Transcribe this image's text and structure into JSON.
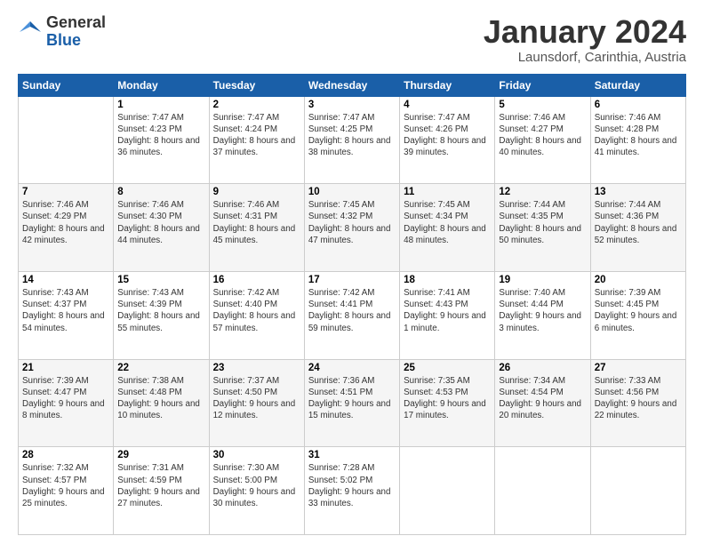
{
  "header": {
    "logo": {
      "line1": "General",
      "line2": "Blue"
    },
    "title": "January 2024",
    "location": "Launsdorf, Carinthia, Austria"
  },
  "weekdays": [
    "Sunday",
    "Monday",
    "Tuesday",
    "Wednesday",
    "Thursday",
    "Friday",
    "Saturday"
  ],
  "weeks": [
    [
      {
        "day": "",
        "sunrise": "",
        "sunset": "",
        "daylight": ""
      },
      {
        "day": "1",
        "sunrise": "Sunrise: 7:47 AM",
        "sunset": "Sunset: 4:23 PM",
        "daylight": "Daylight: 8 hours and 36 minutes."
      },
      {
        "day": "2",
        "sunrise": "Sunrise: 7:47 AM",
        "sunset": "Sunset: 4:24 PM",
        "daylight": "Daylight: 8 hours and 37 minutes."
      },
      {
        "day": "3",
        "sunrise": "Sunrise: 7:47 AM",
        "sunset": "Sunset: 4:25 PM",
        "daylight": "Daylight: 8 hours and 38 minutes."
      },
      {
        "day": "4",
        "sunrise": "Sunrise: 7:47 AM",
        "sunset": "Sunset: 4:26 PM",
        "daylight": "Daylight: 8 hours and 39 minutes."
      },
      {
        "day": "5",
        "sunrise": "Sunrise: 7:46 AM",
        "sunset": "Sunset: 4:27 PM",
        "daylight": "Daylight: 8 hours and 40 minutes."
      },
      {
        "day": "6",
        "sunrise": "Sunrise: 7:46 AM",
        "sunset": "Sunset: 4:28 PM",
        "daylight": "Daylight: 8 hours and 41 minutes."
      }
    ],
    [
      {
        "day": "7",
        "sunrise": "Sunrise: 7:46 AM",
        "sunset": "Sunset: 4:29 PM",
        "daylight": "Daylight: 8 hours and 42 minutes."
      },
      {
        "day": "8",
        "sunrise": "Sunrise: 7:46 AM",
        "sunset": "Sunset: 4:30 PM",
        "daylight": "Daylight: 8 hours and 44 minutes."
      },
      {
        "day": "9",
        "sunrise": "Sunrise: 7:46 AM",
        "sunset": "Sunset: 4:31 PM",
        "daylight": "Daylight: 8 hours and 45 minutes."
      },
      {
        "day": "10",
        "sunrise": "Sunrise: 7:45 AM",
        "sunset": "Sunset: 4:32 PM",
        "daylight": "Daylight: 8 hours and 47 minutes."
      },
      {
        "day": "11",
        "sunrise": "Sunrise: 7:45 AM",
        "sunset": "Sunset: 4:34 PM",
        "daylight": "Daylight: 8 hours and 48 minutes."
      },
      {
        "day": "12",
        "sunrise": "Sunrise: 7:44 AM",
        "sunset": "Sunset: 4:35 PM",
        "daylight": "Daylight: 8 hours and 50 minutes."
      },
      {
        "day": "13",
        "sunrise": "Sunrise: 7:44 AM",
        "sunset": "Sunset: 4:36 PM",
        "daylight": "Daylight: 8 hours and 52 minutes."
      }
    ],
    [
      {
        "day": "14",
        "sunrise": "Sunrise: 7:43 AM",
        "sunset": "Sunset: 4:37 PM",
        "daylight": "Daylight: 8 hours and 54 minutes."
      },
      {
        "day": "15",
        "sunrise": "Sunrise: 7:43 AM",
        "sunset": "Sunset: 4:39 PM",
        "daylight": "Daylight: 8 hours and 55 minutes."
      },
      {
        "day": "16",
        "sunrise": "Sunrise: 7:42 AM",
        "sunset": "Sunset: 4:40 PM",
        "daylight": "Daylight: 8 hours and 57 minutes."
      },
      {
        "day": "17",
        "sunrise": "Sunrise: 7:42 AM",
        "sunset": "Sunset: 4:41 PM",
        "daylight": "Daylight: 8 hours and 59 minutes."
      },
      {
        "day": "18",
        "sunrise": "Sunrise: 7:41 AM",
        "sunset": "Sunset: 4:43 PM",
        "daylight": "Daylight: 9 hours and 1 minute."
      },
      {
        "day": "19",
        "sunrise": "Sunrise: 7:40 AM",
        "sunset": "Sunset: 4:44 PM",
        "daylight": "Daylight: 9 hours and 3 minutes."
      },
      {
        "day": "20",
        "sunrise": "Sunrise: 7:39 AM",
        "sunset": "Sunset: 4:45 PM",
        "daylight": "Daylight: 9 hours and 6 minutes."
      }
    ],
    [
      {
        "day": "21",
        "sunrise": "Sunrise: 7:39 AM",
        "sunset": "Sunset: 4:47 PM",
        "daylight": "Daylight: 9 hours and 8 minutes."
      },
      {
        "day": "22",
        "sunrise": "Sunrise: 7:38 AM",
        "sunset": "Sunset: 4:48 PM",
        "daylight": "Daylight: 9 hours and 10 minutes."
      },
      {
        "day": "23",
        "sunrise": "Sunrise: 7:37 AM",
        "sunset": "Sunset: 4:50 PM",
        "daylight": "Daylight: 9 hours and 12 minutes."
      },
      {
        "day": "24",
        "sunrise": "Sunrise: 7:36 AM",
        "sunset": "Sunset: 4:51 PM",
        "daylight": "Daylight: 9 hours and 15 minutes."
      },
      {
        "day": "25",
        "sunrise": "Sunrise: 7:35 AM",
        "sunset": "Sunset: 4:53 PM",
        "daylight": "Daylight: 9 hours and 17 minutes."
      },
      {
        "day": "26",
        "sunrise": "Sunrise: 7:34 AM",
        "sunset": "Sunset: 4:54 PM",
        "daylight": "Daylight: 9 hours and 20 minutes."
      },
      {
        "day": "27",
        "sunrise": "Sunrise: 7:33 AM",
        "sunset": "Sunset: 4:56 PM",
        "daylight": "Daylight: 9 hours and 22 minutes."
      }
    ],
    [
      {
        "day": "28",
        "sunrise": "Sunrise: 7:32 AM",
        "sunset": "Sunset: 4:57 PM",
        "daylight": "Daylight: 9 hours and 25 minutes."
      },
      {
        "day": "29",
        "sunrise": "Sunrise: 7:31 AM",
        "sunset": "Sunset: 4:59 PM",
        "daylight": "Daylight: 9 hours and 27 minutes."
      },
      {
        "day": "30",
        "sunrise": "Sunrise: 7:30 AM",
        "sunset": "Sunset: 5:00 PM",
        "daylight": "Daylight: 9 hours and 30 minutes."
      },
      {
        "day": "31",
        "sunrise": "Sunrise: 7:28 AM",
        "sunset": "Sunset: 5:02 PM",
        "daylight": "Daylight: 9 hours and 33 minutes."
      },
      {
        "day": "",
        "sunrise": "",
        "sunset": "",
        "daylight": ""
      },
      {
        "day": "",
        "sunrise": "",
        "sunset": "",
        "daylight": ""
      },
      {
        "day": "",
        "sunrise": "",
        "sunset": "",
        "daylight": ""
      }
    ]
  ]
}
